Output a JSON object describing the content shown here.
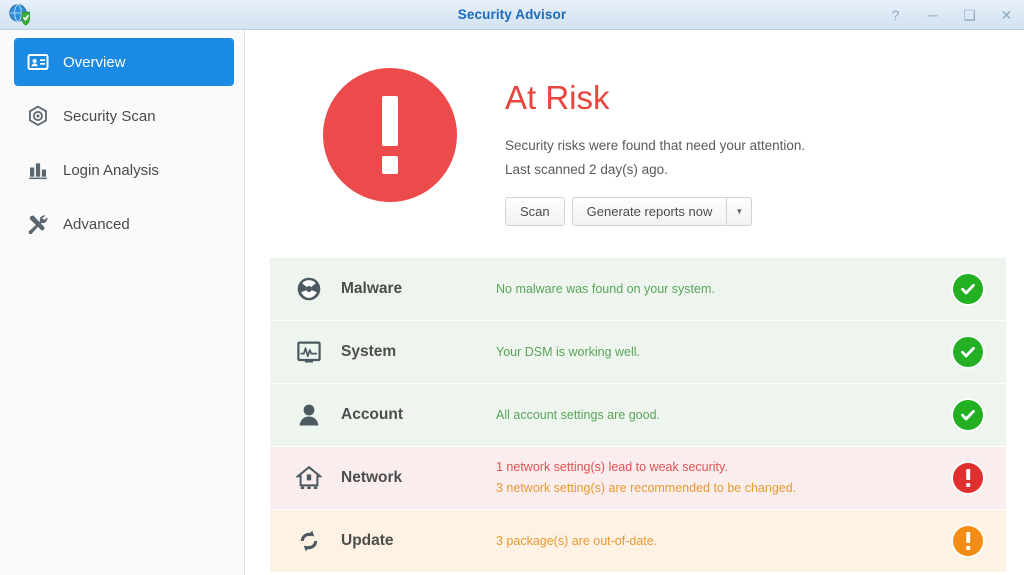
{
  "window": {
    "title": "Security Advisor",
    "app_icon": "shield-globe-icon",
    "controls": [
      {
        "name": "help",
        "glyph": "?"
      },
      {
        "name": "minimize",
        "glyph": "─"
      },
      {
        "name": "maximize",
        "glyph": "❑"
      },
      {
        "name": "close",
        "glyph": "✕"
      }
    ]
  },
  "sidebar": {
    "items": [
      {
        "label": "Overview",
        "icon": "id-card-icon",
        "active": true
      },
      {
        "label": "Security Scan",
        "icon": "target-icon",
        "active": false
      },
      {
        "label": "Login Analysis",
        "icon": "bar-chart-icon",
        "active": false
      },
      {
        "label": "Advanced",
        "icon": "tools-icon",
        "active": false
      }
    ]
  },
  "hero": {
    "status_icon": "exclamation-circle-icon",
    "title": "At Risk",
    "line1": "Security risks were found that need your attention.",
    "line2": "Last scanned 2 day(s) ago.",
    "scan_button": "Scan",
    "reports_button": "Generate reports now",
    "reports_dropdown_glyph": "▼"
  },
  "status_rows": [
    {
      "label": "Malware",
      "icon": "radiation-icon",
      "tone": "ok",
      "badge": "check-circle-icon",
      "messages": [
        {
          "text": "No malware was found on your system.",
          "tone": "green"
        }
      ]
    },
    {
      "label": "System",
      "icon": "monitor-waveform-icon",
      "tone": "ok",
      "badge": "check-circle-icon",
      "messages": [
        {
          "text": "Your DSM is working well.",
          "tone": "green"
        }
      ]
    },
    {
      "label": "Account",
      "icon": "user-icon",
      "tone": "ok",
      "badge": "check-circle-icon",
      "messages": [
        {
          "text": "All account settings are good.",
          "tone": "green"
        }
      ]
    },
    {
      "label": "Network",
      "icon": "router-house-icon",
      "tone": "danger",
      "badge": "exclamation-circle-icon",
      "messages": [
        {
          "text": "1 network setting(s) lead to weak security.",
          "tone": "red"
        },
        {
          "text": "3 network setting(s) are recommended to be changed.",
          "tone": "orange"
        }
      ]
    },
    {
      "label": "Update",
      "icon": "refresh-icon",
      "tone": "warn",
      "badge": "exclamation-circle-icon",
      "messages": [
        {
          "text": "3 package(s) are out-of-date.",
          "tone": "orange"
        }
      ]
    }
  ],
  "colors": {
    "accent_blue": "#1a8ae5",
    "title_blue": "#1a6bbd",
    "risk_red": "#ed4b4b",
    "ok_green": "#23b123",
    "warn_orange": "#f28c15",
    "danger_red": "#e02f2f"
  }
}
